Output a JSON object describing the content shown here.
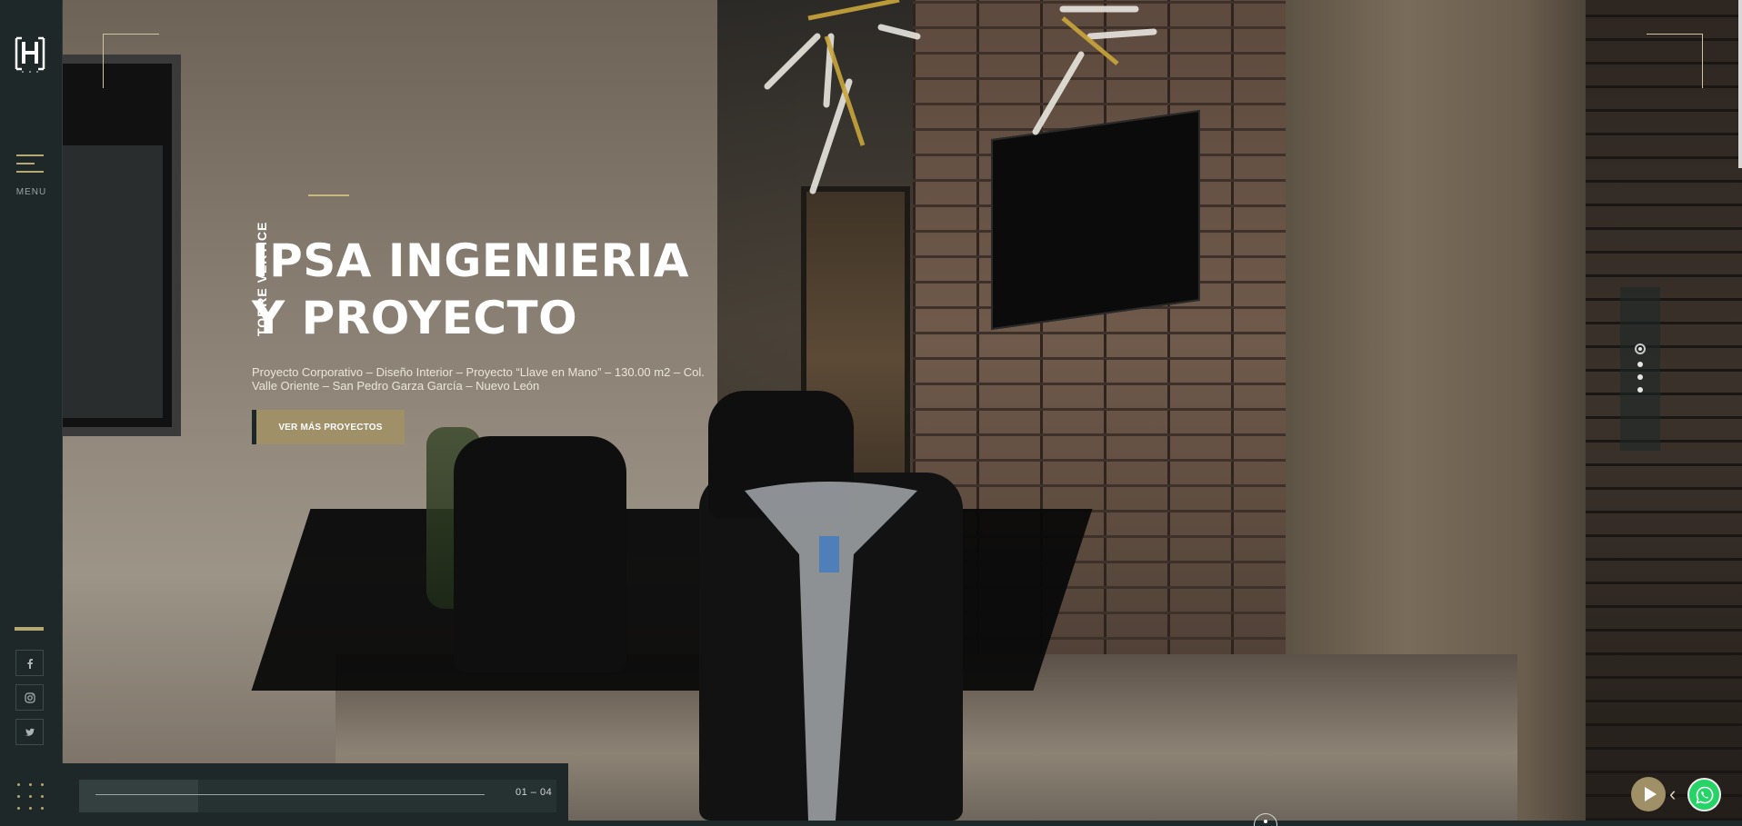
{
  "sidebar": {
    "menu_label": "MENU",
    "social": [
      {
        "name": "facebook",
        "icon": "f"
      },
      {
        "name": "instagram",
        "icon": "◎"
      },
      {
        "name": "twitter",
        "icon": "t"
      }
    ]
  },
  "hero": {
    "vertical_label": "TORRE VERTICE",
    "title_line1": "IPSA INGENIERIA",
    "title_line2": "Y PROYECTO",
    "description": "Proyecto Corporativo – Diseño Interior – Proyecto “Llave en Mano” – 130.00 m2 – Col. Valle Oriente – San Pedro Garza García – Nuevo León",
    "cta_label": "VER MÁS PROYECTOS"
  },
  "slider": {
    "counter": "01 – 04",
    "progress": 0.25,
    "total_dots": 4,
    "active_dot": 1
  },
  "colors": {
    "accent": "#b5a872",
    "button": "#9f9068",
    "sidebar_bg": "#1e2828",
    "whatsapp": "#25d366"
  }
}
